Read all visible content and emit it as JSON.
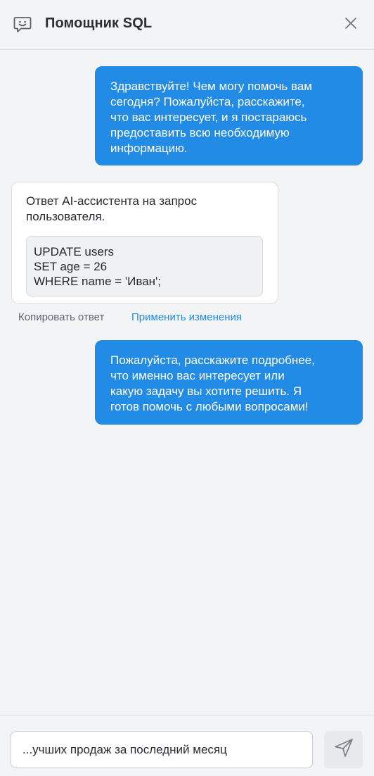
{
  "header": {
    "title": "Помощник SQL",
    "icons": {
      "chat": "chat-smile-icon",
      "close": "close-icon"
    }
  },
  "messages": [
    {
      "role": "user",
      "lines": [
        "Здравствуйте! Чем могу помочь вам",
        "сегодня? Пожалуйста, расскажите,",
        "что вас интересует, и я постараюсь",
        "предоставить всю необходимую",
        "информацию."
      ]
    },
    {
      "role": "assistant",
      "lines": [
        "Ответ AI-ассистента на запрос",
        "пользователя."
      ],
      "code": [
        "UPDATE users",
        "SET age = 26",
        "WHERE name = 'Иван';"
      ],
      "actions": {
        "copy": "Копировать ответ",
        "apply": "Применить изменения"
      }
    },
    {
      "role": "user",
      "lines": [
        "Пожалуйста, расскажите подробнее,",
        "что именно вас интересует или",
        "какую задачу вы хотите решить. Я",
        "готов помочь с любыми вопросами!"
      ]
    }
  ],
  "composer": {
    "value": "...учших продаж за последний месяц",
    "send_icon": "send-icon"
  },
  "colors": {
    "accent": "#228be6",
    "background": "#f3f4f6",
    "muted_text": "#5e6470"
  }
}
